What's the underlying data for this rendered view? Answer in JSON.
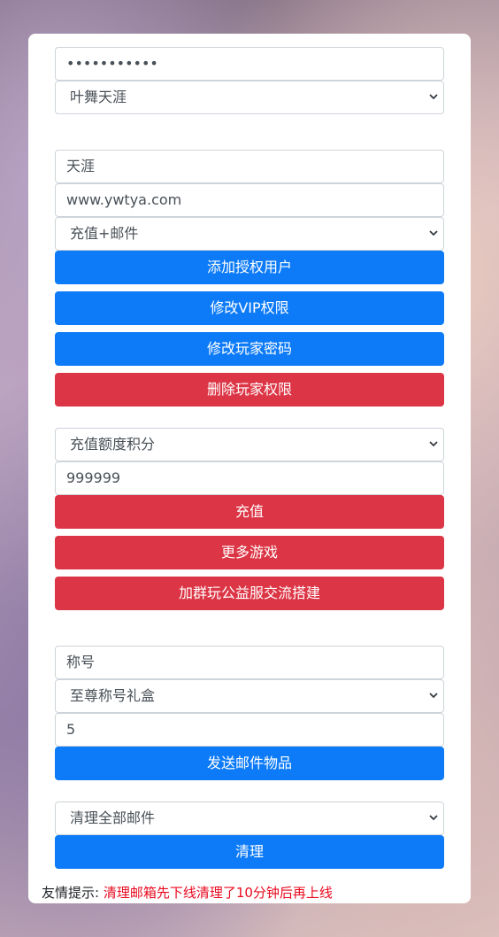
{
  "colors": {
    "primary": "#0d7bf7",
    "danger": "#dc3545",
    "tip_red": "#e8091e"
  },
  "login": {
    "password_value": "•••••••••••",
    "server_select": "叶舞天涯"
  },
  "auth": {
    "username_value": "天涯",
    "site_value": "www.ywtya.com",
    "permission_select": "充值+邮件",
    "add_user_label": "添加授权用户",
    "modify_vip_label": "修改VIP权限",
    "modify_password_label": "修改玩家密码",
    "delete_permission_label": "删除玩家权限"
  },
  "recharge": {
    "type_select": "充值额度积分",
    "amount_value": "999999",
    "recharge_label": "充值",
    "more_games_label": "更多游戏",
    "join_group_label": "加群玩公益服交流搭建"
  },
  "mail": {
    "title_value": "称号",
    "item_select": "至尊称号礼盒",
    "quantity_value": "5",
    "send_label": "发送邮件物品"
  },
  "clean": {
    "mode_select": "清理全部邮件",
    "clean_label": "清理"
  },
  "tip": {
    "prefix": "友情提示: ",
    "message": "清理邮箱先下线清理了10分钟后再上线"
  },
  "icons": {
    "select_arrow": "chevron-down-icon"
  }
}
